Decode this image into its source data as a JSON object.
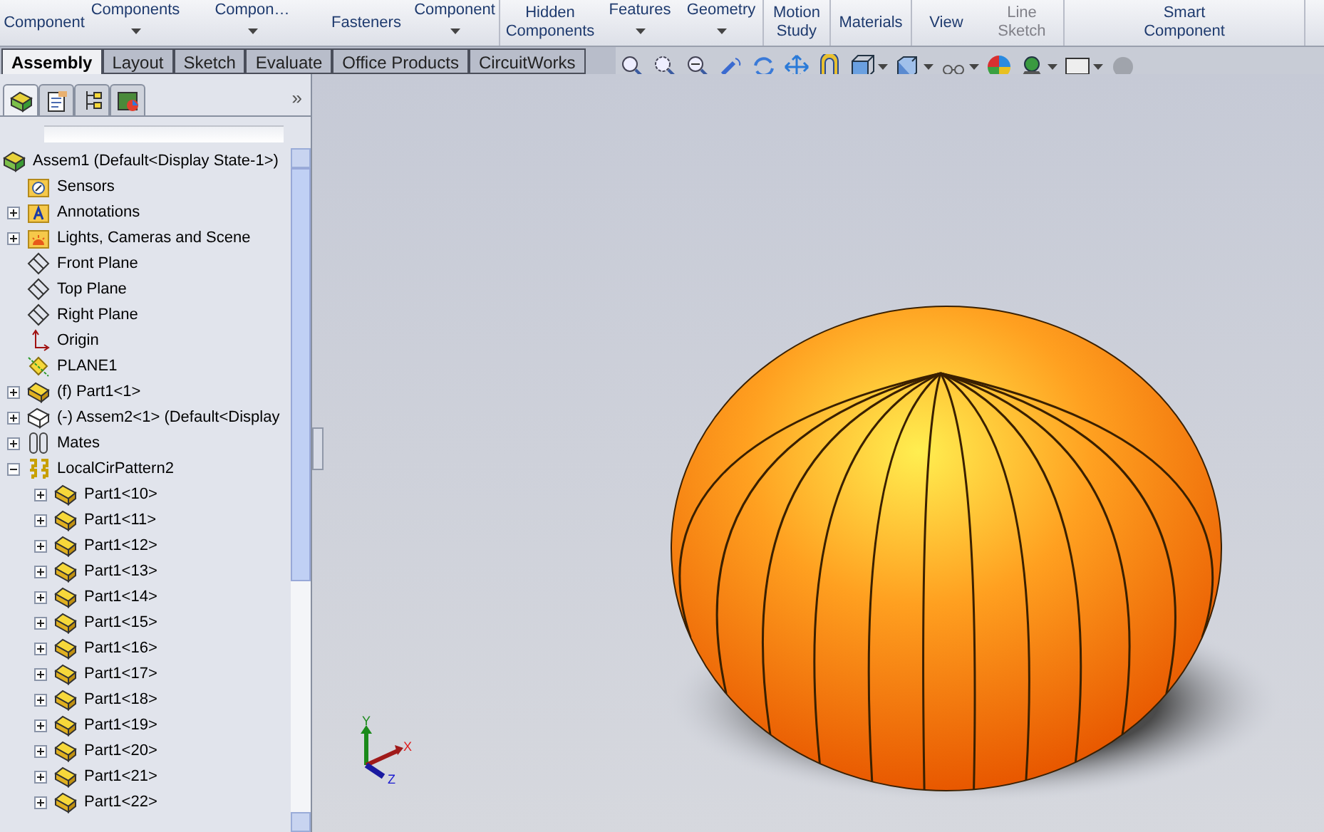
{
  "ribbon": {
    "groups": [
      [
        {
          "kind": "single",
          "lines": [
            "Component"
          ],
          "disabled": false
        },
        {
          "kind": "dropdown",
          "lines": [
            "Components"
          ],
          "disabled": false
        },
        {
          "kind": "dropdown",
          "lines": [
            "Compon…"
          ],
          "disabled": false
        },
        {
          "kind": "single",
          "lines": [
            "Fasteners"
          ],
          "disabled": false
        },
        {
          "kind": "dropdown",
          "lines": [
            "Component"
          ],
          "disabled": false
        }
      ],
      [
        {
          "kind": "double",
          "lines": [
            "Hidden",
            "Components"
          ],
          "disabled": false
        },
        {
          "kind": "dropdown",
          "lines": [
            "Features"
          ],
          "disabled": false
        },
        {
          "kind": "dropdown",
          "lines": [
            "Geometry"
          ],
          "disabled": false
        }
      ],
      [
        {
          "kind": "double",
          "lines": [
            "Motion",
            "Study"
          ],
          "disabled": false
        }
      ],
      [
        {
          "kind": "single",
          "lines": [
            "Materials"
          ],
          "disabled": false
        }
      ],
      [
        {
          "kind": "single",
          "lines": [
            "View"
          ],
          "disabled": false
        },
        {
          "kind": "double",
          "lines": [
            "Line",
            "Sketch"
          ],
          "disabled": true
        }
      ],
      [
        {
          "kind": "double",
          "lines": [
            "Smart",
            "Component"
          ],
          "disabled": false
        }
      ]
    ]
  },
  "tabs": [
    {
      "label": "Assembly",
      "selected": true
    },
    {
      "label": "Layout",
      "selected": false
    },
    {
      "label": "Sketch",
      "selected": false
    },
    {
      "label": "Evaluate",
      "selected": false
    },
    {
      "label": "Office Products",
      "selected": false
    },
    {
      "label": "CircuitWorks",
      "selected": false
    }
  ],
  "panel_tabs": [
    {
      "kind": "tree",
      "selected": true
    },
    {
      "kind": "properties",
      "selected": false
    },
    {
      "kind": "config",
      "selected": false
    },
    {
      "kind": "display",
      "selected": false
    }
  ],
  "panel_more": "»",
  "tree": [
    {
      "label": "Assem1  (Default<Display State-1>)",
      "kind": "assembly",
      "children": [
        {
          "label": "Sensors",
          "kind": "sensors"
        },
        {
          "label": "Annotations",
          "kind": "annotations",
          "expanded": false
        },
        {
          "label": "Lights, Cameras and Scene",
          "kind": "lights",
          "expanded": false
        },
        {
          "label": "Front Plane",
          "kind": "plane"
        },
        {
          "label": "Top Plane",
          "kind": "plane"
        },
        {
          "label": "Right Plane",
          "kind": "plane"
        },
        {
          "label": "Origin",
          "kind": "origin"
        },
        {
          "label": "PLANE1",
          "kind": "refplane"
        },
        {
          "label": "(f) Part1<1>",
          "kind": "part",
          "expanded": false
        },
        {
          "label": "(-) Assem2<1> (Default<Display",
          "kind": "subassembly",
          "expanded": false
        },
        {
          "label": "Mates",
          "kind": "mates",
          "expanded": false
        },
        {
          "label": "LocalCirPattern2",
          "kind": "pattern",
          "expanded": true,
          "children": [
            {
              "label": "Part1<10>",
              "kind": "part",
              "expanded": false
            },
            {
              "label": "Part1<11>",
              "kind": "part",
              "expanded": false
            },
            {
              "label": "Part1<12>",
              "kind": "part",
              "expanded": false
            },
            {
              "label": "Part1<13>",
              "kind": "part",
              "expanded": false
            },
            {
              "label": "Part1<14>",
              "kind": "part",
              "expanded": false
            },
            {
              "label": "Part1<15>",
              "kind": "part",
              "expanded": false
            },
            {
              "label": "Part1<16>",
              "kind": "part",
              "expanded": false
            },
            {
              "label": "Part1<17>",
              "kind": "part",
              "expanded": false
            },
            {
              "label": "Part1<18>",
              "kind": "part",
              "expanded": false
            },
            {
              "label": "Part1<19>",
              "kind": "part",
              "expanded": false
            },
            {
              "label": "Part1<20>",
              "kind": "part",
              "expanded": false
            },
            {
              "label": "Part1<21>",
              "kind": "part",
              "expanded": false
            },
            {
              "label": "Part1<22>",
              "kind": "part",
              "expanded": false
            }
          ]
        }
      ]
    }
  ],
  "triad": {
    "x": "X",
    "y": "Y",
    "z": "Z"
  }
}
